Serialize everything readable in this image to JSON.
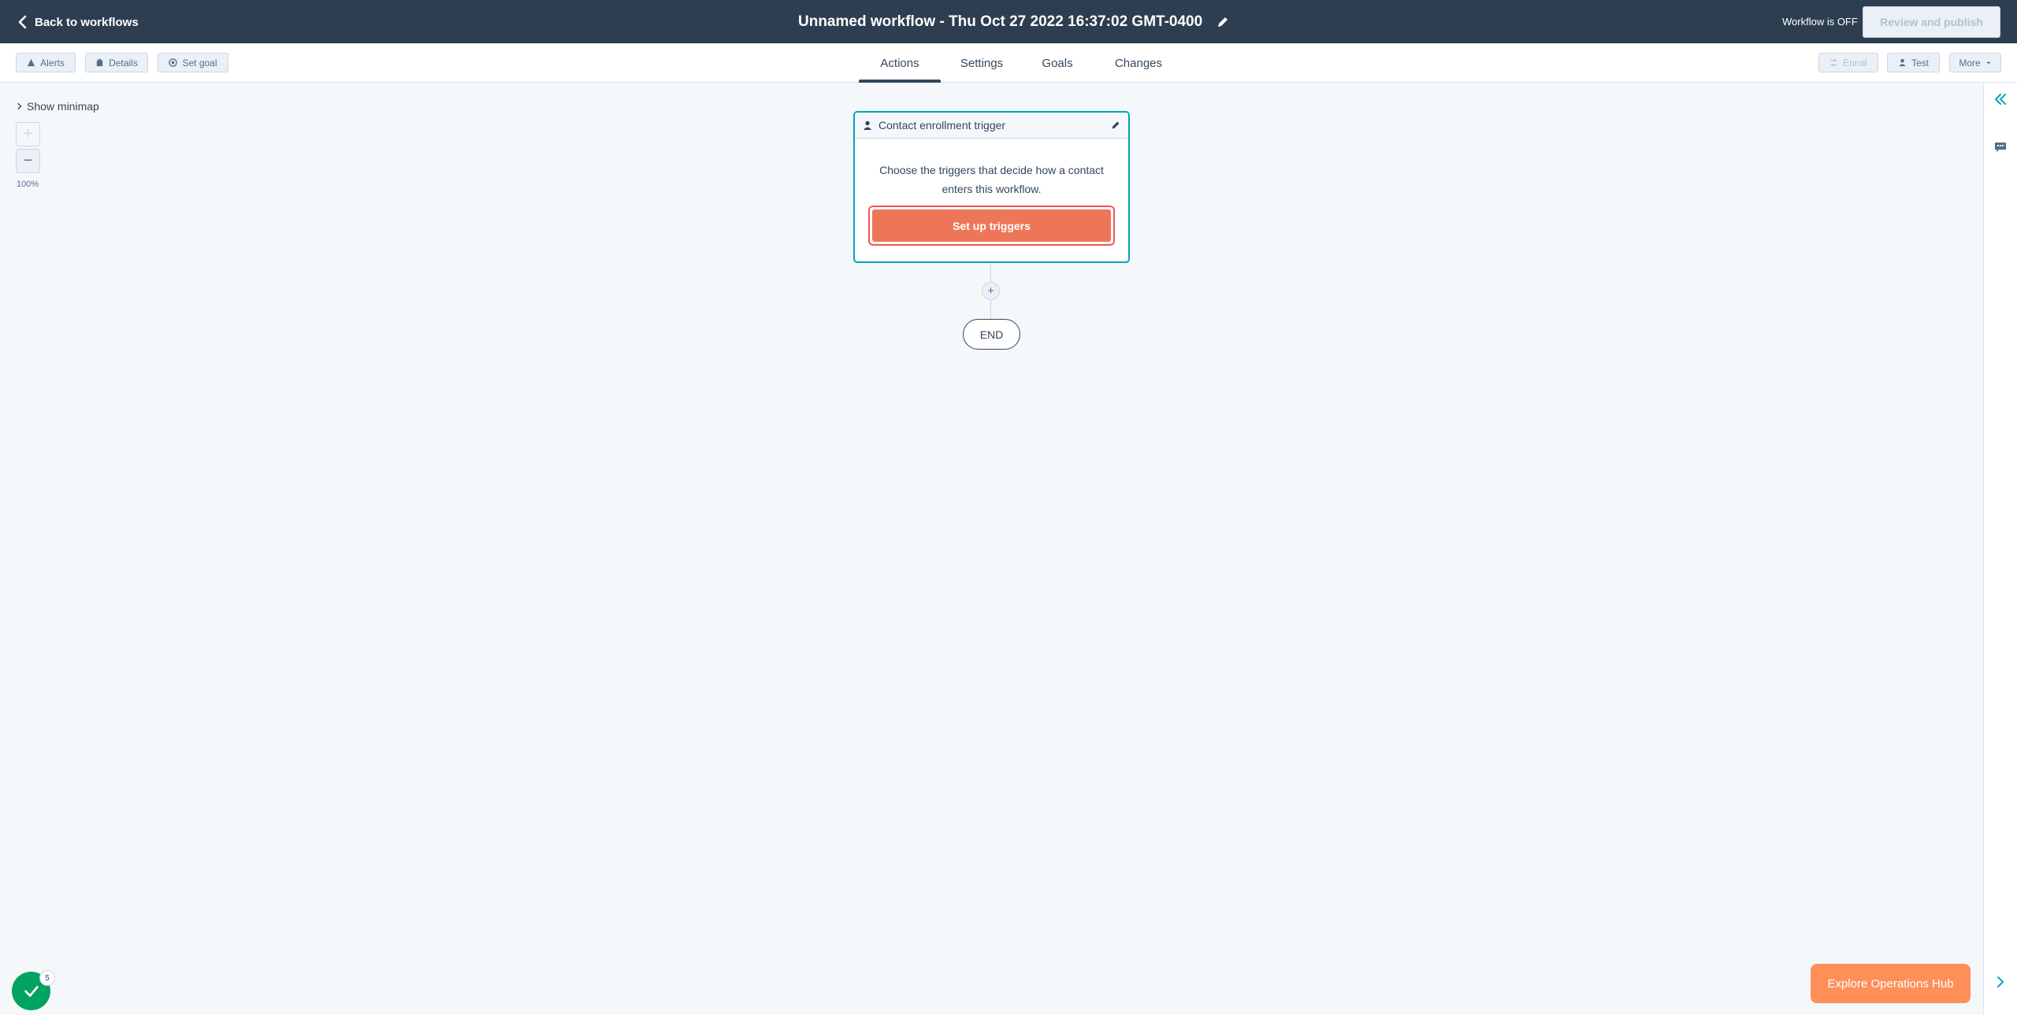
{
  "header": {
    "back_label": "Back to workflows",
    "title": "Unnamed workflow - Thu Oct 27 2022 16:37:02 GMT-0400",
    "status": "Workflow is OFF",
    "review_label": "Review and publish"
  },
  "toolbar": {
    "alerts_label": "Alerts",
    "details_label": "Details",
    "set_goal_label": "Set goal",
    "enroll_label": "Enroll",
    "test_label": "Test",
    "more_label": "More"
  },
  "tabs": [
    {
      "label": "Actions",
      "active": true
    },
    {
      "label": "Settings",
      "active": false
    },
    {
      "label": "Goals",
      "active": false
    },
    {
      "label": "Changes",
      "active": false
    }
  ],
  "canvas": {
    "minimap_label": "Show minimap",
    "zoom_in_label": "+",
    "zoom_out_label": "−",
    "zoom_level": "100%"
  },
  "trigger_card": {
    "title": "Contact enrollment trigger",
    "description": "Choose the triggers that decide how a contact enters this workflow.",
    "button_label": "Set up triggers"
  },
  "flow": {
    "add_label": "+",
    "end_label": "END"
  },
  "footer": {
    "badge_count": "5",
    "explore_label": "Explore Operations Hub"
  },
  "colors": {
    "header_bg": "#2d3e50",
    "accent_teal": "#00a4bd",
    "cta_orange": "#ee7658",
    "cta_outline": "#f2545b",
    "success_green": "#00a35f",
    "explore_orange": "#ff8f59"
  }
}
